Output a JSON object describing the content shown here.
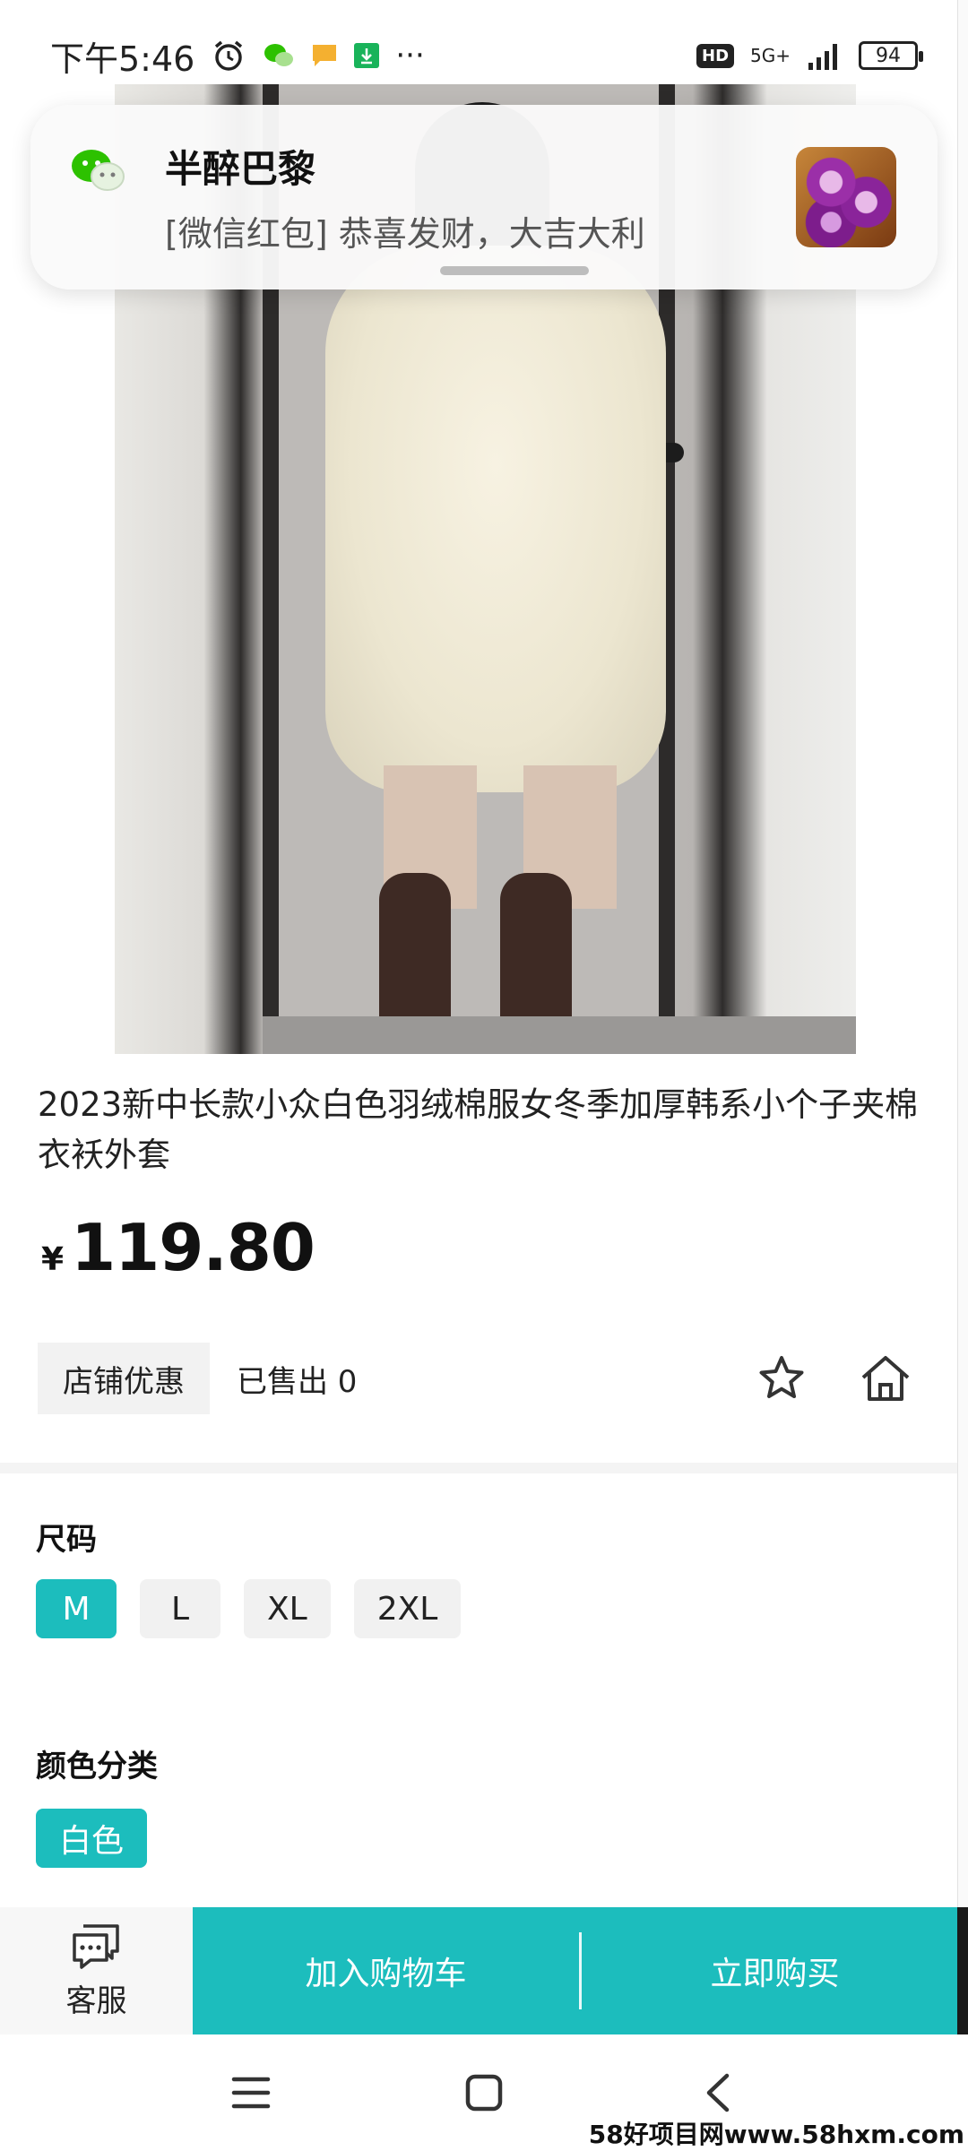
{
  "status_bar": {
    "time": "下午5:46",
    "more": "···",
    "hd": "HD",
    "network": "5G+",
    "battery": "94"
  },
  "notification": {
    "app_icon": "wechat-icon",
    "sender": "半醉巴黎",
    "message": "[微信红包] 恭喜发财，大吉大利"
  },
  "product": {
    "title": "2023新中长款小众白色羽绒棉服女冬季加厚韩系小个子夹棉衣袄外套",
    "price_symbol": "¥",
    "price": "119.80",
    "shop_coupon": "店铺优惠",
    "sold": "已售出 0"
  },
  "options": {
    "size_label": "尺码",
    "sizes": [
      "M",
      "L",
      "XL",
      "2XL"
    ],
    "selected_size": "M",
    "color_label": "颜色分类",
    "colors": [
      "白色"
    ],
    "selected_color": "白色"
  },
  "actions": {
    "service": "客服",
    "add_to_cart": "加入购物车",
    "buy_now": "立即购买"
  },
  "colors": {
    "accent": "#1cbdbd"
  },
  "watermark": "58好项目网www.58hxm.com"
}
